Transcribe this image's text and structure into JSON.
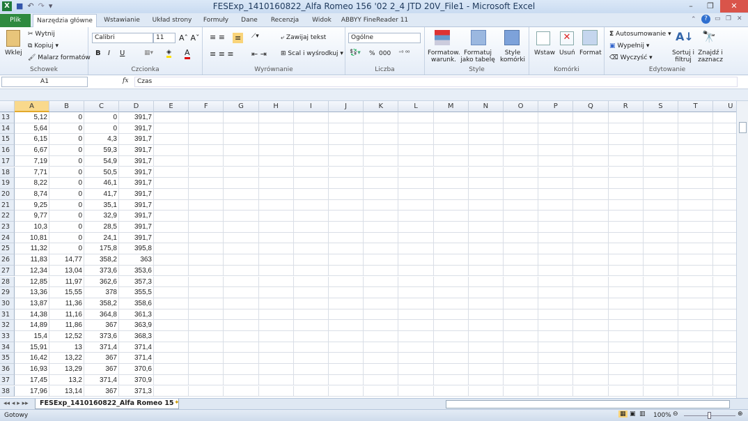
{
  "window": {
    "title": "FESExp_1410160822_Alfa Romeo 156 '02 2_4 JTD 20V_File1 - Microsoft Excel"
  },
  "tabs": [
    "Plik",
    "Narzędzia główne",
    "Wstawianie",
    "Układ strony",
    "Formuły",
    "Dane",
    "Recenzja",
    "Widok",
    "ABBYY FineReader 11"
  ],
  "ribbon": {
    "clipboard": {
      "label": "Schowek",
      "paste": "Wklej",
      "cut": "Wytnij",
      "copy": "Kopiuj",
      "painter": "Malarz formatów"
    },
    "font": {
      "label": "Czcionka",
      "name": "Calibri",
      "size": "11",
      "bold": "B",
      "italic": "I",
      "underline": "U"
    },
    "alignment": {
      "label": "Wyrównanie",
      "wrap": "Zawijaj tekst",
      "merge": "Scal i wyśrodkuj"
    },
    "number": {
      "label": "Liczba",
      "format": "Ogólne",
      "percent": "%",
      "thousands": "000"
    },
    "styles": {
      "label": "Style",
      "conditional": "Formatow. warunk.",
      "table": "Formatuj jako tabelę",
      "cell": "Style komórki"
    },
    "cells": {
      "label": "Komórki",
      "insert": "Wstaw",
      "delete": "Usuń",
      "format": "Format"
    },
    "editing": {
      "label": "Edytowanie",
      "autosum": "Autosumowanie",
      "fill": "Wypełnij",
      "clear": "Wyczyść",
      "sort": "Sortuj i filtruj",
      "find": "Znajdź i zaznacz"
    }
  },
  "formula_bar": {
    "name_box": "A1",
    "fx": "fx",
    "content": "Czas"
  },
  "columns": [
    "A",
    "B",
    "C",
    "D",
    "E",
    "F",
    "G",
    "H",
    "I",
    "J",
    "K",
    "L",
    "M",
    "N",
    "O",
    "P",
    "Q",
    "R",
    "S",
    "T",
    "U"
  ],
  "rows": [
    [
      "13",
      "5,12",
      "0",
      "0",
      "391,7"
    ],
    [
      "14",
      "5,64",
      "0",
      "0",
      "391,7"
    ],
    [
      "15",
      "6,15",
      "0",
      "4,3",
      "391,7"
    ],
    [
      "16",
      "6,67",
      "0",
      "59,3",
      "391,7"
    ],
    [
      "17",
      "7,19",
      "0",
      "54,9",
      "391,7"
    ],
    [
      "18",
      "7,71",
      "0",
      "50,5",
      "391,7"
    ],
    [
      "19",
      "8,22",
      "0",
      "46,1",
      "391,7"
    ],
    [
      "20",
      "8,74",
      "0",
      "41,7",
      "391,7"
    ],
    [
      "21",
      "9,25",
      "0",
      "35,1",
      "391,7"
    ],
    [
      "22",
      "9,77",
      "0",
      "32,9",
      "391,7"
    ],
    [
      "23",
      "10,3",
      "0",
      "28,5",
      "391,7"
    ],
    [
      "24",
      "10,81",
      "0",
      "24,1",
      "391,7"
    ],
    [
      "25",
      "11,32",
      "0",
      "175,8",
      "395,8"
    ],
    [
      "26",
      "11,83",
      "14,77",
      "358,2",
      "363"
    ],
    [
      "27",
      "12,34",
      "13,04",
      "373,6",
      "353,6"
    ],
    [
      "28",
      "12,85",
      "11,97",
      "362,6",
      "357,3"
    ],
    [
      "29",
      "13,36",
      "15,55",
      "378",
      "355,5"
    ],
    [
      "30",
      "13,87",
      "11,36",
      "358,2",
      "358,6"
    ],
    [
      "31",
      "14,38",
      "11,16",
      "364,8",
      "361,3"
    ],
    [
      "32",
      "14,89",
      "11,86",
      "367",
      "363,9"
    ],
    [
      "33",
      "15,4",
      "12,52",
      "373,6",
      "368,3"
    ],
    [
      "34",
      "15,91",
      "13",
      "371,4",
      "371,4"
    ],
    [
      "35",
      "16,42",
      "13,22",
      "367",
      "371,4"
    ],
    [
      "36",
      "16,93",
      "13,29",
      "367",
      "370,6"
    ],
    [
      "37",
      "17,45",
      "13,2",
      "371,4",
      "370,9"
    ],
    [
      "38",
      "17,96",
      "13,14",
      "367",
      "371,3"
    ]
  ],
  "sheet_tab": "FESExp_1410160822_Alfa Romeo 15",
  "status": {
    "ready": "Gotowy",
    "zoom": "100%"
  }
}
